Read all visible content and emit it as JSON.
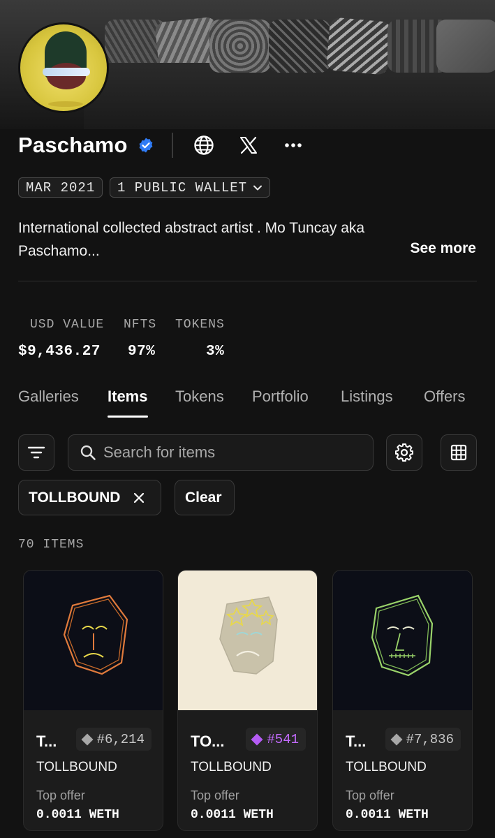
{
  "profile": {
    "name": "Paschamo",
    "joined": "MAR 2021",
    "wallets": "1 PUBLIC WALLET",
    "bio": "International collected abstract artist . Mo Tuncay aka Paschamo...",
    "see_more": "See more"
  },
  "stats": {
    "usd_label": "USD VALUE",
    "usd_value": "$9,436.27",
    "nfts_label": "NFTS",
    "nfts_value": "97%",
    "tokens_label": "TOKENS",
    "tokens_value": "3%"
  },
  "tabs": [
    {
      "label": "Galleries"
    },
    {
      "label": "Items",
      "active": true
    },
    {
      "label": "Tokens"
    },
    {
      "label": "Portfolio"
    },
    {
      "label": "Listings"
    },
    {
      "label": "Offers"
    }
  ],
  "search": {
    "placeholder": "Search for items"
  },
  "filters": {
    "chip": "TOLLBOUND",
    "clear": "Clear"
  },
  "items_count": "70 ITEMS",
  "items": [
    {
      "title": "T...",
      "number": "#6,214",
      "rarity": "common",
      "collection": "TOLLBOUND",
      "offer_label": "Top offer",
      "offer": "0.0011 WETH",
      "art_color": "#e07a3c"
    },
    {
      "title": "TO...",
      "number": "#541",
      "rarity": "rare",
      "collection": "TOLLBOUND",
      "offer_label": "Top offer",
      "offer": "0.0011 WETH",
      "art_color": "#e8d84a"
    },
    {
      "title": "T...",
      "number": "#7,836",
      "rarity": "common",
      "collection": "TOLLBOUND",
      "offer_label": "Top offer",
      "offer": "0.0011 WETH",
      "art_color": "#9ad36a"
    }
  ],
  "colors": {
    "background": "#121212",
    "accent_rare": "#b55cf5",
    "verified": "#2f7bf5"
  }
}
